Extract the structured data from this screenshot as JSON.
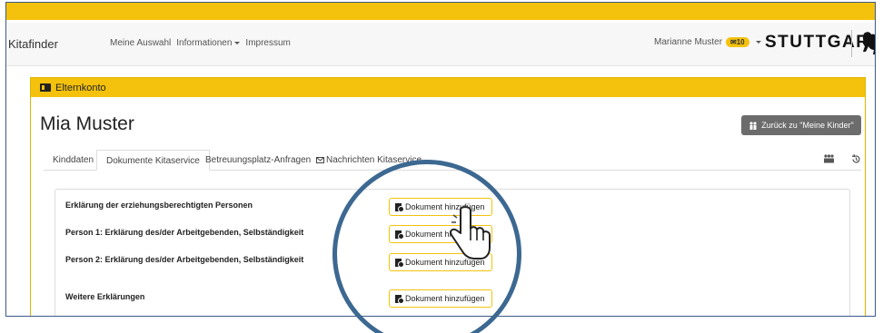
{
  "navbar": {
    "brand": "Kitafinder",
    "links": [
      "Meine Auswahl",
      "Informationen",
      "Impressum"
    ],
    "user_name": "Marianne Muster",
    "message_badge": "✉10",
    "logo_text": "STUTTGART"
  },
  "panel": {
    "header_title": "Elternkonto",
    "child_name": "Mia Muster",
    "back_button": "Zurück zu \"Meine Kinder\""
  },
  "tabs": [
    "Kinddaten",
    "Dokumente Kitaservice",
    "Betreuungsplatz-Anfragen",
    "Nachrichten Kitaservice"
  ],
  "rows": [
    {
      "label": "Erklärung der erziehungsberechtigten Personen",
      "button": "Dokument hinzufügen"
    },
    {
      "label": "Person 1: Erklärung des/der Arbeitgebenden, Selbständigkeit",
      "button": "Dokument hinzufügen"
    },
    {
      "label": "Person 2: Erklärung des/der Arbeitgebenden, Selbständigkeit",
      "button": "Dokument hinzufügen"
    },
    {
      "label": "Weitere Erklärungen",
      "button": "Dokument hinzufügen"
    }
  ],
  "colors": {
    "accent": "#f4c20d",
    "highlight_circle": "#3c6891",
    "back_button": "#6c6c6c"
  }
}
